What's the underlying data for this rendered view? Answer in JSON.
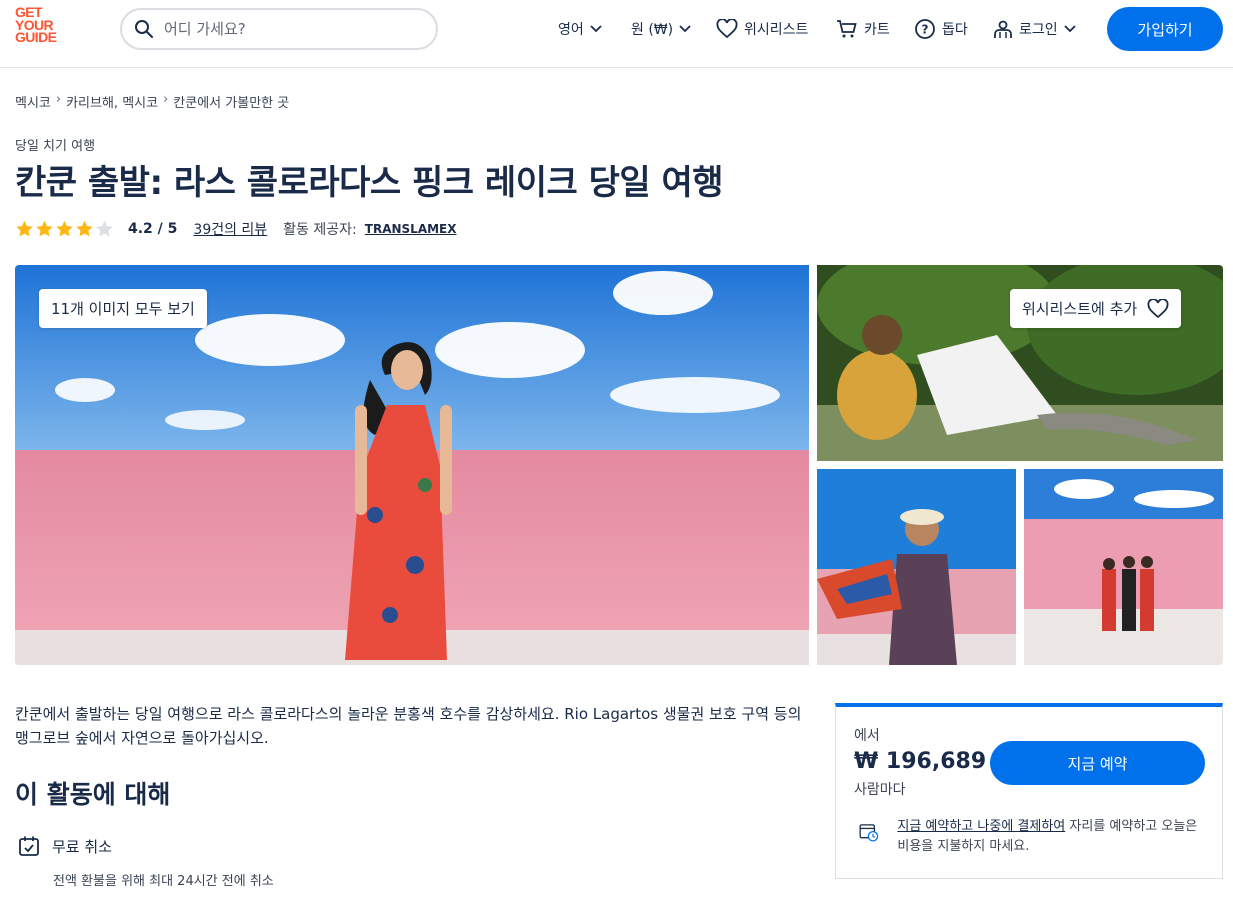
{
  "header": {
    "logo_lines": [
      "GET",
      "YOUR",
      "GUIDE"
    ],
    "search_placeholder": "어디 가세요?",
    "language": "영어",
    "currency": "원 (₩)",
    "wishlist": "위시리스트",
    "cart": "카트",
    "help": "돕다",
    "login": "로그인",
    "signup": "가입하기"
  },
  "breadcrumb": [
    "멕시코",
    "카리브해, 멕시코",
    "칸쿤에서 가볼만한 곳"
  ],
  "breadcrumb_sep": "›",
  "activity": {
    "category": "당일 치기 여행",
    "title": "칸쿤 출발: 라스 콜로라다스 핑크 레이크 당일 여행",
    "rating": "4.2 / 5",
    "rating_stars": 4.2,
    "reviews": "39건의 리뷰",
    "provider_label": "활동 제공자:",
    "provider": "TRANSLAMEX"
  },
  "gallery": {
    "view_all": "11개 이미지 모두 보기",
    "add_wishlist": "위시리스트에 추가"
  },
  "description": "칸쿤에서 출발하는 당일 여행으로 라스 콜로라다스의 놀라운 분홍색 호수를 감상하세요. Rio Lagartos 생물권 보호 구역 등의 맹그로브 숲에서 자연으로 돌아가십시오.",
  "about": {
    "heading": "이 활동에 대해",
    "features": [
      {
        "title": "무료 취소",
        "subtitle": "전액 환불을 위해 최대 24시간 전에 취소"
      }
    ]
  },
  "booking": {
    "from": "에서",
    "price": "₩ 196,689",
    "per": "사람마다",
    "button": "지금 예약",
    "reserve_link": "지금 예약하고 나중에 결제하여",
    "reserve_rest": " 자리를 예약하고 오늘은 비용을 지불하지 마세요."
  },
  "colors": {
    "primary": "#0071eb",
    "brand": "#ff5533",
    "text": "#1a2b49",
    "star": "#fdb818"
  }
}
